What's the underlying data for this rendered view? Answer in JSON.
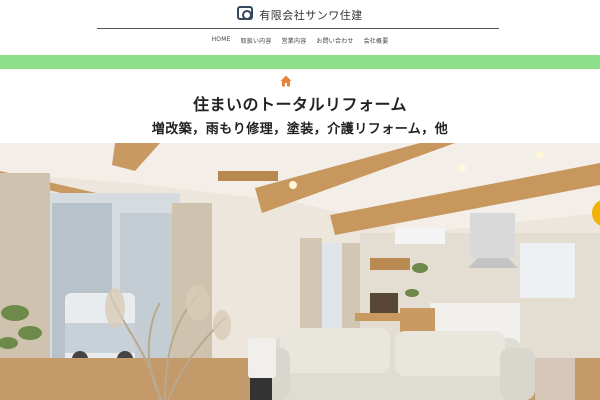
{
  "header": {
    "logo_icon": "company-logo-icon",
    "company_name": "有限会社サンワ住建"
  },
  "nav": {
    "items": [
      "HOME",
      "取扱い内容",
      "営業内容",
      "お問い合わせ",
      "会社概要"
    ]
  },
  "hero": {
    "icon": "house-icon",
    "title": "住まいのトータルリフォーム",
    "subtitle": "増改築，雨もり修理，塗装，介護リフォーム，他"
  },
  "photo": {
    "subject": "living-room-photo"
  },
  "colors": {
    "accent_green": "#8ee08a",
    "house_icon": "#e8843a",
    "logo": "#34495e"
  }
}
